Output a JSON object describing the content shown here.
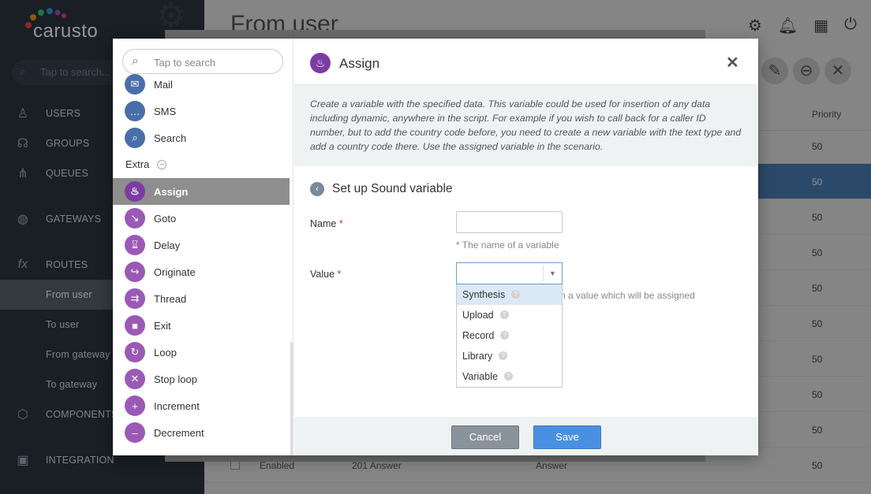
{
  "app": {
    "logo": "carusto",
    "page_title": "From user"
  },
  "sidebar": {
    "search_placeholder": "Tap to search...",
    "items": [
      {
        "label": "USERS",
        "icon": "user-icon"
      },
      {
        "label": "GROUPS",
        "icon": "group-icon"
      },
      {
        "label": "QUEUES",
        "icon": "queue-icon"
      },
      {
        "label": "GATEWAYS",
        "icon": "globe-icon"
      },
      {
        "label": "ROUTES",
        "icon": "function-icon"
      },
      {
        "label": "COMPONENTS",
        "icon": "cube-icon"
      },
      {
        "label": "INTEGRATION",
        "icon": "integration-icon"
      }
    ],
    "subitems": [
      "From user",
      "To user",
      "From gateway",
      "To gateway"
    ],
    "selected_subitem": "From user"
  },
  "table": {
    "priority_header": "Priority",
    "priorities": [
      "50",
      "50",
      "50",
      "50",
      "50",
      "50",
      "50",
      "50",
      "50",
      "50"
    ],
    "last_row": {
      "status": "Enabled",
      "name": "201 Answer",
      "action": "Answer",
      "priority": "50"
    }
  },
  "palette": {
    "search_placeholder": "Tap to search",
    "items_top": [
      {
        "label": "Mail",
        "icon": "mail-icon"
      },
      {
        "label": "SMS",
        "icon": "sms-icon"
      },
      {
        "label": "Search",
        "icon": "search-icon"
      }
    ],
    "extra_label": "Extra",
    "items_extra": [
      {
        "label": "Assign",
        "icon": "flame-icon"
      },
      {
        "label": "Goto",
        "icon": "goto-icon"
      },
      {
        "label": "Delay",
        "icon": "hourglass-icon"
      },
      {
        "label": "Originate",
        "icon": "originate-icon"
      },
      {
        "label": "Thread",
        "icon": "thread-icon"
      },
      {
        "label": "Exit",
        "icon": "stop-icon"
      },
      {
        "label": "Loop",
        "icon": "loop-icon"
      },
      {
        "label": "Stop loop",
        "icon": "stop-loop-icon"
      },
      {
        "label": "Increment",
        "icon": "plus-icon"
      },
      {
        "label": "Decrement",
        "icon": "minus-icon"
      }
    ],
    "selected": "Assign"
  },
  "dialog": {
    "title": "Assign",
    "description": "Create a variable with the specified data. This variable could be used for insertion of any data including dynamic, anywhere in the script. For example if you wish to call back for a caller ID number, but to add the country code before, you need to create a new variable with the text type and add a country code there. Use the assigned variable in the scenario.",
    "section_title": "Set up Sound variable",
    "name_label": "Name",
    "name_value": "",
    "name_hint": "* The name of a variable",
    "value_label": "Value",
    "value_selected": "",
    "value_hint_partial": "n a value which will be assigned",
    "required_mark": "*",
    "options": [
      "Synthesis",
      "Upload",
      "Record",
      "Library",
      "Variable"
    ],
    "highlighted_option": "Synthesis",
    "cancel_label": "Cancel",
    "save_label": "Save"
  }
}
